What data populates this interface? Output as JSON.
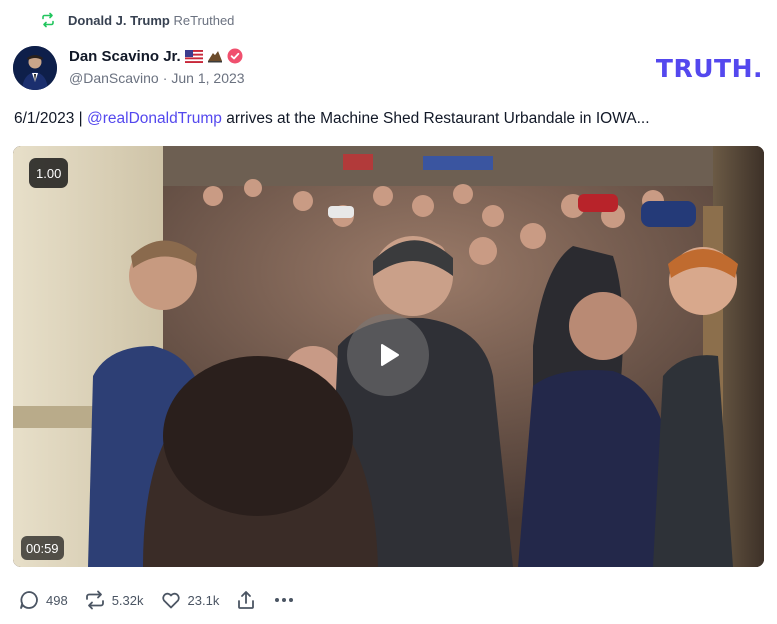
{
  "retruth": {
    "name": "Donald J. Trump",
    "label": "ReTruthed",
    "icon": "retruth-icon",
    "icon_color": "#22c55e"
  },
  "author": {
    "display_name": "Dan Scavino Jr.",
    "handle": "@DanScavino",
    "separator": "·",
    "date": "Jun 1, 2023",
    "badges": [
      "us-flag-icon",
      "eagle-icon",
      "verified-badge-icon"
    ],
    "verified_color": "#f0506e"
  },
  "brand": {
    "logo_text": "TRUTH",
    "logo_dot": ".",
    "color": "#5448ee"
  },
  "post": {
    "text_prefix": "6/1/2023 | ",
    "mention": "@realDonaldTrump",
    "text_suffix": " arrives at the Machine Shed Restaurant Urbandale in IOWA..."
  },
  "video": {
    "playback_speed": "1.00",
    "duration": "00:59",
    "play_icon": "play-icon"
  },
  "actions": {
    "replies": "498",
    "retruths": "5.32k",
    "likes": "23.1k",
    "share_icon": "share-icon",
    "more_icon": "more-icon"
  }
}
